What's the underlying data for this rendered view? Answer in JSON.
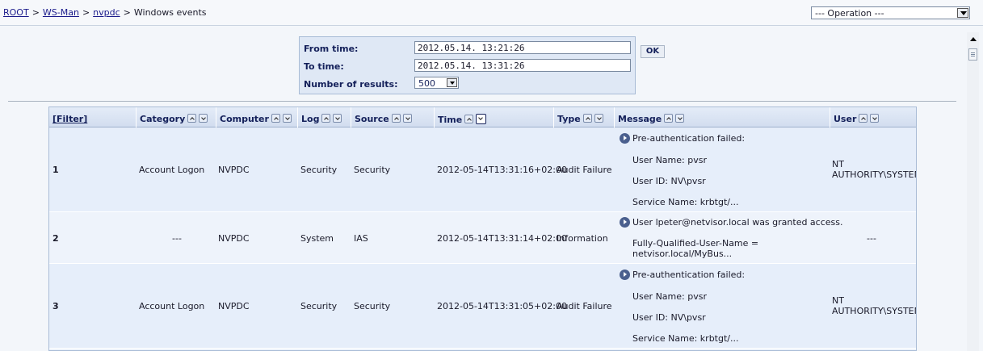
{
  "breadcrumb": {
    "items": [
      "ROOT",
      "WS-Man",
      "nvpdc"
    ],
    "current": "Windows events",
    "separator": ">"
  },
  "operation_select": {
    "value": "--- Operation ---"
  },
  "filter_panel": {
    "from_label": "From time:",
    "from_value": "2012.05.14. 13:21:26",
    "to_label": "To time:",
    "to_value": "2012.05.14. 13:31:26",
    "results_label": "Number of results:",
    "results_value": "500",
    "ok_label": "OK"
  },
  "table": {
    "filter_label": "[Filter]",
    "columns": [
      "Category",
      "Computer",
      "Log",
      "Source",
      "Time",
      "Type",
      "Message",
      "User"
    ],
    "rows": [
      {
        "num": "1",
        "category": "Account Logon",
        "computer": "NVPDC",
        "log": "Security",
        "source": "Security",
        "time": "2012-05-14T13:31:16+02:00",
        "type": "Audit Failure",
        "message": [
          "Pre-authentication failed:",
          "User Name: pvsr",
          "User ID: NV\\pvsr",
          "Service Name: krbtgt/..."
        ],
        "user": [
          "NT",
          "AUTHORITY\\SYSTEM"
        ]
      },
      {
        "num": "2",
        "category": "---",
        "computer": "NVPDC",
        "log": "System",
        "source": "IAS",
        "time": "2012-05-14T13:31:14+02:00",
        "type": "Information",
        "message": [
          "User lpeter@netvisor.local was granted access.",
          "Fully-Qualified-User-Name =",
          "netvisor.local/MyBus..."
        ],
        "user": [
          "---"
        ]
      },
      {
        "num": "3",
        "category": "Account Logon",
        "computer": "NVPDC",
        "log": "Security",
        "source": "Security",
        "time": "2012-05-14T13:31:05+02:00",
        "type": "Audit Failure",
        "message": [
          "Pre-authentication failed:",
          "User Name: pvsr",
          "User ID: NV\\pvsr",
          "Service Name: krbtgt/..."
        ],
        "user": [
          "NT",
          "AUTHORITY\\SYSTEM"
        ]
      }
    ]
  }
}
